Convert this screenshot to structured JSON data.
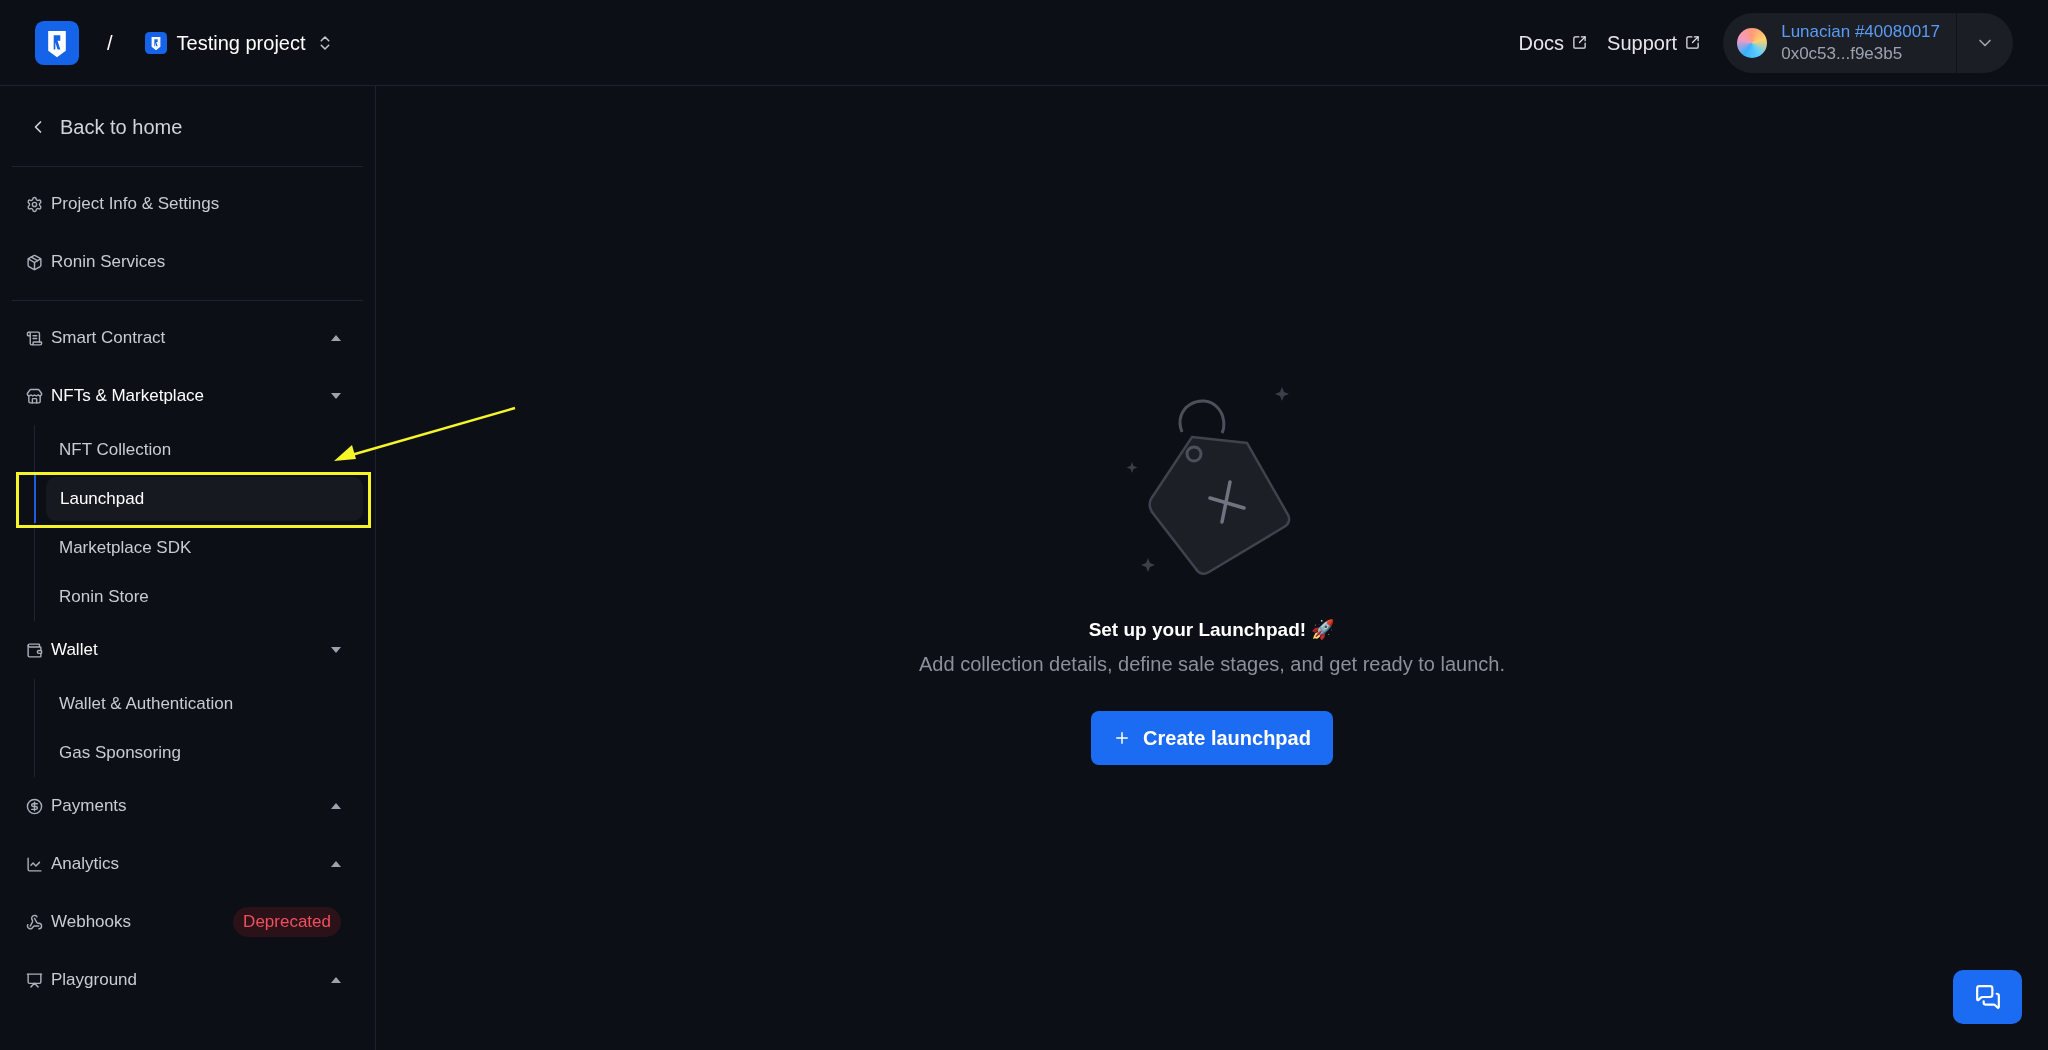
{
  "header": {
    "separator": "/",
    "project": "Testing project",
    "links": [
      "Docs",
      "Support"
    ],
    "account": {
      "name": "Lunacian #40080017",
      "address": "0x0c53...f9e3b5"
    }
  },
  "sidebar": {
    "back": "Back to home",
    "groups": [
      {
        "items": [
          {
            "kind": "link",
            "label": "Project Info & Settings"
          },
          {
            "kind": "link",
            "label": "Ronin Services"
          }
        ]
      },
      {
        "items": [
          {
            "kind": "group",
            "label": "Smart Contract",
            "expanded": false
          },
          {
            "kind": "group",
            "label": "NFTs & Marketplace",
            "expanded": true,
            "children": [
              {
                "label": "NFT Collection",
                "selected": false
              },
              {
                "label": "Launchpad",
                "selected": true
              },
              {
                "label": "Marketplace SDK",
                "selected": false
              },
              {
                "label": "Ronin Store",
                "selected": false
              }
            ]
          },
          {
            "kind": "group",
            "label": "Wallet",
            "expanded": true,
            "children": [
              {
                "label": "Wallet & Authentication",
                "selected": false
              },
              {
                "label": "Gas Sponsoring",
                "selected": false
              }
            ]
          },
          {
            "kind": "group",
            "label": "Payments",
            "expanded": false
          },
          {
            "kind": "group",
            "label": "Analytics",
            "expanded": false
          },
          {
            "kind": "link",
            "label": "Webhooks",
            "badge": "Deprecated"
          },
          {
            "kind": "group",
            "label": "Playground",
            "expanded": false
          }
        ]
      }
    ]
  },
  "empty_state": {
    "title": "Set up your Launchpad! 🚀",
    "description": "Add collection details, define sale stages, and get ready to launch.",
    "button": "Create launchpad"
  }
}
